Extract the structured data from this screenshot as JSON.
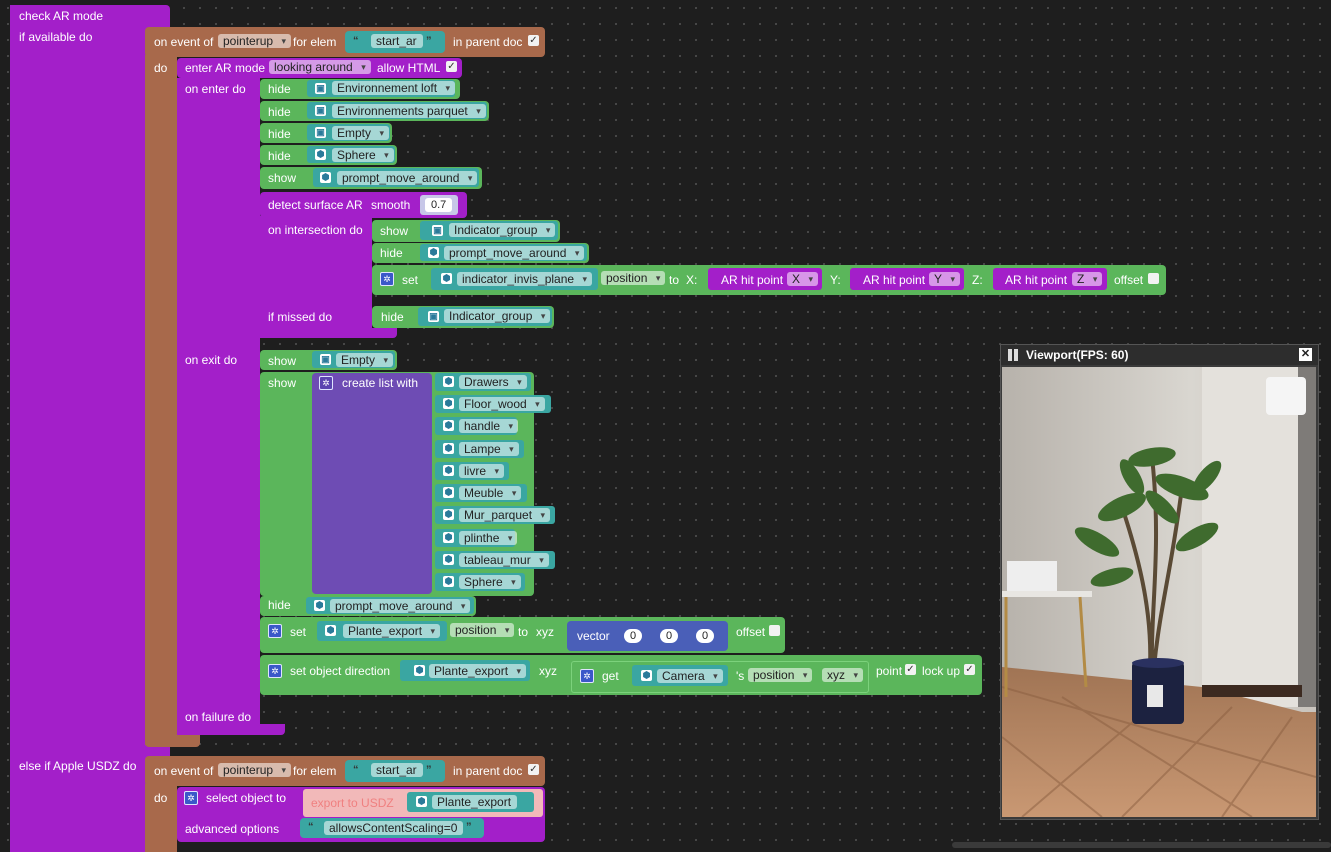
{
  "top": {
    "check_ar_mode": "check AR mode",
    "if_available_do": "if available do",
    "else_if_usdz": "else if Apple USDZ do"
  },
  "event1": {
    "on_event_of": "on event of",
    "event": "pointerup",
    "for_elem": "for elem",
    "elem": "start_ar",
    "in_parent_doc": "in parent doc"
  },
  "do_label": "do",
  "enter": {
    "label": "enter AR mode",
    "mode": "looking around",
    "allow_html": "allow HTML",
    "on_enter_do": "on enter do",
    "on_exit_do": "on exit do",
    "on_failure_do": "on failure do"
  },
  "hide_label": "hide",
  "show_label": "show",
  "set_label": "set",
  "enter_rows": [
    {
      "action": "hide",
      "object": "Environnement loft",
      "icon": "group-icon"
    },
    {
      "action": "hide",
      "object": "Environnements parquet",
      "icon": "group-icon"
    },
    {
      "action": "hide",
      "object": "Empty",
      "icon": "group-icon"
    },
    {
      "action": "hide",
      "object": "Sphere",
      "icon": "mesh-icon"
    },
    {
      "action": "show",
      "object": "prompt_move_around",
      "icon": "mesh-icon"
    }
  ],
  "detect": {
    "label": "detect surface AR",
    "smooth": "smooth",
    "value": "0.7",
    "on_intersection_do": "on intersection do",
    "if_missed_do": "if missed do"
  },
  "intersection": {
    "show_obj": "Indicator_group",
    "hide_obj": "prompt_move_around",
    "set_obj": "indicator_invis_plane",
    "prop": "position",
    "to": "to",
    "x": "X:",
    "y": "Y:",
    "z": "Z:",
    "hit": "AR hit point",
    "hx": "X",
    "hy": "Y",
    "hz": "Z",
    "offset": "offset"
  },
  "missed_obj": "Indicator_group",
  "exit": {
    "show1": "Empty",
    "create_list": "create list with",
    "list": [
      "Drawers",
      "Floor_wood",
      "handle",
      "Lampe",
      "livre",
      "Meuble",
      "Mur_parquet",
      "plinthe",
      "tableau_mur",
      "Sphere"
    ],
    "hide_obj": "prompt_move_around",
    "set_obj": "Plante_export",
    "set_prop": "position",
    "to": "to",
    "xyz": "xyz",
    "vector": "vector",
    "v": [
      "0",
      "0",
      "0"
    ],
    "offset": "offset",
    "dir_label": "set object direction",
    "dir_obj": "Plante_export",
    "dir_xyz": "xyz",
    "get": "get",
    "get_obj": "Camera",
    "get_s": "'s",
    "get_prop": "position",
    "get_xyz": "xyz",
    "point": "point",
    "lock_up": "lock up"
  },
  "event2": {
    "on_event_of": "on event of",
    "event": "pointerup",
    "for_elem": "for elem",
    "elem": "start_ar",
    "in_parent_doc": "in parent doc",
    "select_object": "select object to",
    "export_usdz": "export to USDZ",
    "export_obj": "Plante_export",
    "advanced": "advanced options",
    "adv_value": "allowsContentScaling=0"
  },
  "viewport": {
    "title": "Viewport(FPS: 60)"
  }
}
